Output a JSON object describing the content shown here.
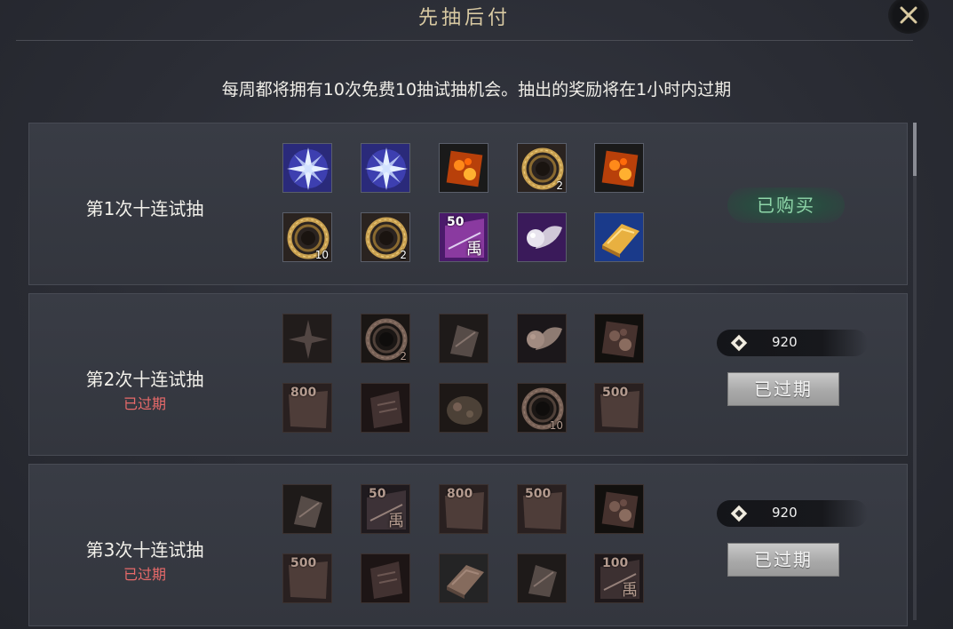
{
  "dialog": {
    "title": "先抽后付",
    "notice": "每周都将拥有10次免费10抽试抽机会。抽出的奖励将在1小时内过期"
  },
  "rows": [
    {
      "label": "第1次十连试抽",
      "status": "",
      "action_label": "已购买",
      "items": [
        {
          "icon": "blue-star-gem",
          "count": ""
        },
        {
          "icon": "blue-star-gem",
          "count": ""
        },
        {
          "icon": "orange-crystal",
          "count": ""
        },
        {
          "icon": "gold-ring",
          "count": "2"
        },
        {
          "icon": "orange-crystal",
          "count": ""
        },
        {
          "icon": "gold-ring",
          "count": "10"
        },
        {
          "icon": "gold-ring",
          "count": "2"
        },
        {
          "icon": "voucher-50",
          "count": "",
          "tag": "50",
          "glyph": "禹"
        },
        {
          "icon": "pearl-shell",
          "count": ""
        },
        {
          "icon": "gold-ingot",
          "count": ""
        }
      ]
    },
    {
      "label": "第2次十连试抽",
      "status": "已过期",
      "price": "920",
      "action_label": "已过期",
      "items": [
        {
          "icon": "star-gem",
          "count": ""
        },
        {
          "icon": "gold-ring",
          "count": "2"
        },
        {
          "icon": "feather-scroll",
          "count": ""
        },
        {
          "icon": "pearl-shell",
          "count": ""
        },
        {
          "icon": "orange-crystal",
          "count": ""
        },
        {
          "icon": "voucher-800",
          "count": "",
          "tag": "800"
        },
        {
          "icon": "red-book",
          "count": ""
        },
        {
          "icon": "green-herb",
          "count": ""
        },
        {
          "icon": "gold-ring",
          "count": "10"
        },
        {
          "icon": "voucher-500",
          "count": "",
          "tag": "500"
        }
      ]
    },
    {
      "label": "第3次十连试抽",
      "status": "已过期",
      "price": "920",
      "action_label": "已过期",
      "items": [
        {
          "icon": "feather-scroll",
          "count": ""
        },
        {
          "icon": "voucher-50",
          "count": "",
          "tag": "50",
          "glyph": "禹"
        },
        {
          "icon": "voucher-800",
          "count": "",
          "tag": "800"
        },
        {
          "icon": "voucher-500",
          "count": "",
          "tag": "500"
        },
        {
          "icon": "orange-crystal",
          "count": ""
        },
        {
          "icon": "voucher-500",
          "count": "",
          "tag": "500"
        },
        {
          "icon": "red-book",
          "count": ""
        },
        {
          "icon": "gold-ingot",
          "count": ""
        },
        {
          "icon": "feather-scroll",
          "count": ""
        },
        {
          "icon": "voucher-100",
          "count": "",
          "tag": "100",
          "glyph": "禹"
        }
      ]
    }
  ],
  "colors": {
    "expired_text": "#e86a6a",
    "bought_text": "#8fd6a9",
    "title_text": "#d8c9a2"
  }
}
